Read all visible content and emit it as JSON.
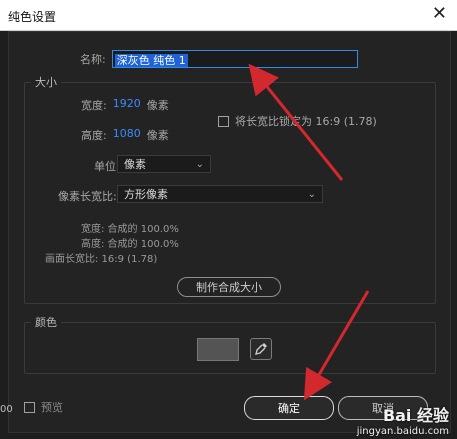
{
  "window": {
    "title": "纯色设置",
    "close_symbol": "✕"
  },
  "name_field": {
    "label": "名称:",
    "value": "深灰色 纯色 1"
  },
  "size_group": {
    "title": "大小",
    "width_label": "宽度:",
    "width_value": "1920",
    "width_unit": "像素",
    "height_label": "高度:",
    "height_value": "1080",
    "height_unit": "像素",
    "lock_aspect_label": "将长宽比锁定为 16:9 (1.78)",
    "unit_label": "单位:",
    "unit_value": "像素",
    "pixel_aspect_label": "像素长宽比:",
    "pixel_aspect_value": "方形像素",
    "info_width": "宽度: 合成的 100.0%",
    "info_height": "高度: 合成的 100.0%",
    "info_frame_aspect": "画面长宽比: 16:9 (1.78)",
    "make_comp_size_button": "制作合成大小"
  },
  "color_group": {
    "title": "颜色",
    "swatch_color": "#545454"
  },
  "footer": {
    "preview_label": "预览",
    "ok_label": "确定",
    "cancel_label": "取消"
  },
  "watermark": {
    "brand": "Bai 经验",
    "url": "jingyan.baidu.com"
  },
  "left_stub": "00",
  "colors": {
    "accent": "#3d8bfd",
    "arrow": "#d4282f",
    "selection": "#1f63d6"
  }
}
